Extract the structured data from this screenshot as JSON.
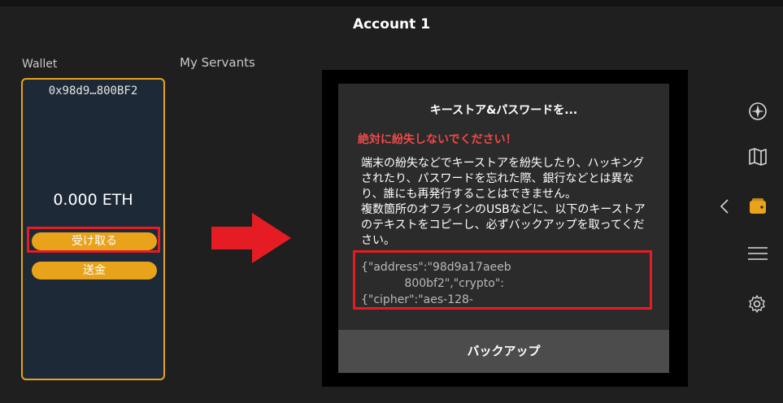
{
  "header": {
    "title": "Account 1"
  },
  "sections": {
    "wallet_label": "Wallet",
    "servants_label": "My Servants"
  },
  "wallet": {
    "address": "0x98d9…800BF2",
    "balance": "0.000 ETH",
    "receive_label": "受け取る",
    "send_label": "送金"
  },
  "dialog": {
    "title": "キーストア&パスワードを...",
    "warning": "絶対に紛失しないでください！",
    "body": "端末の紛失などでキーストアを紛失したり、ハッキングされたり、パスワードを忘れた際、銀行などとは異なり、誰にも再発行することはできません。\n複数箇所のオフラインのUSBなどに、以下のキーストアのテキストをコピーし、必ずバックアップを取ってください。",
    "keystore_text": "{\"address\":\"98d9a17aeeb\n            800bf2\",\"crypto\":\n{\"cipher\":\"aes-128-",
    "backup_label": "バックアップ"
  },
  "colors": {
    "accent": "#e8a31b",
    "highlight": "#e51c23",
    "card_bg": "#1d2936",
    "warning": "#ef4848"
  },
  "sidebar": {
    "icons": [
      "compass-icon",
      "map-icon",
      "wallet-icon",
      "menu-icon",
      "gear-icon"
    ],
    "active": "wallet-icon"
  }
}
